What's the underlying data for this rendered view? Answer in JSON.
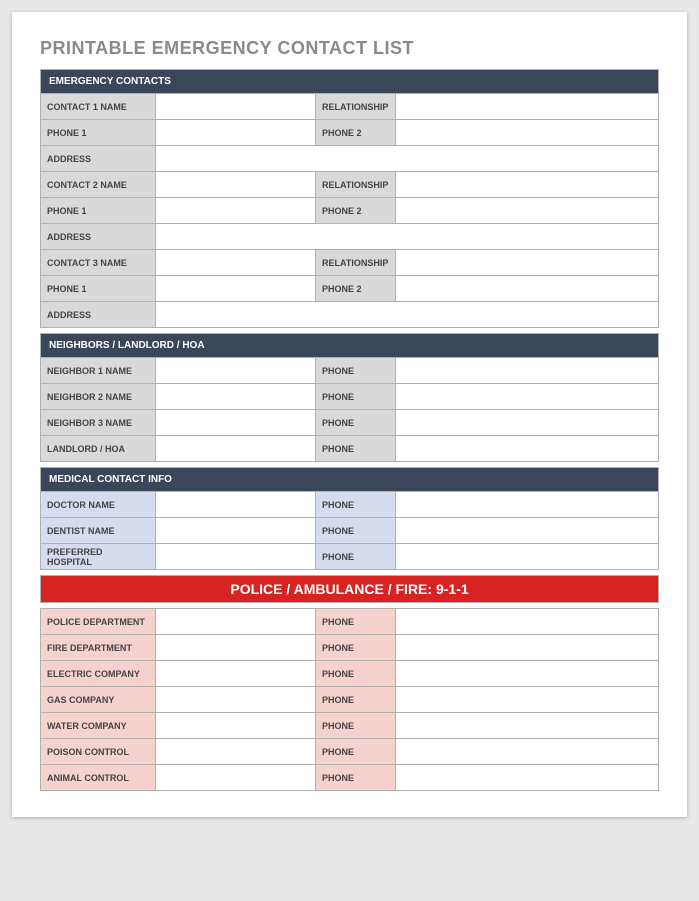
{
  "title": "PRINTABLE EMERGENCY CONTACT LIST",
  "sections": {
    "emergency": {
      "header": "EMERGENCY CONTACTS",
      "contacts": [
        {
          "name_label": "CONTACT 1 NAME",
          "rel_label": "RELATIONSHIP",
          "phone1_label": "PHONE 1",
          "phone2_label": "PHONE 2",
          "addr_label": "ADDRESS"
        },
        {
          "name_label": "CONTACT 2 NAME",
          "rel_label": "RELATIONSHIP",
          "phone1_label": "PHONE 1",
          "phone2_label": "PHONE 2",
          "addr_label": "ADDRESS"
        },
        {
          "name_label": "CONTACT 3 NAME",
          "rel_label": "RELATIONSHIP",
          "phone1_label": "PHONE 1",
          "phone2_label": "PHONE 2",
          "addr_label": "ADDRESS"
        }
      ]
    },
    "neighbors": {
      "header": "NEIGHBORS / LANDLORD / HOA",
      "rows": [
        {
          "label": "NEIGHBOR 1 NAME",
          "phone_label": "PHONE"
        },
        {
          "label": "NEIGHBOR 2 NAME",
          "phone_label": "PHONE"
        },
        {
          "label": "NEIGHBOR 3 NAME",
          "phone_label": "PHONE"
        },
        {
          "label": "LANDLORD / HOA",
          "phone_label": "PHONE"
        }
      ]
    },
    "medical": {
      "header": "MEDICAL CONTACT INFO",
      "rows": [
        {
          "label": "DOCTOR NAME",
          "phone_label": "PHONE"
        },
        {
          "label": "DENTIST NAME",
          "phone_label": "PHONE"
        },
        {
          "label": "PREFERRED HOSPITAL",
          "phone_label": "PHONE"
        }
      ]
    },
    "services": {
      "header": "POLICE / AMBULANCE / FIRE:  9-1-1",
      "rows": [
        {
          "label": "POLICE DEPARTMENT",
          "phone_label": "PHONE"
        },
        {
          "label": "FIRE DEPARTMENT",
          "phone_label": "PHONE"
        },
        {
          "label": "ELECTRIC COMPANY",
          "phone_label": "PHONE"
        },
        {
          "label": "GAS COMPANY",
          "phone_label": "PHONE"
        },
        {
          "label": "WATER COMPANY",
          "phone_label": "PHONE"
        },
        {
          "label": "POISON CONTROL",
          "phone_label": "PHONE"
        },
        {
          "label": "ANIMAL CONTROL",
          "phone_label": "PHONE"
        }
      ]
    }
  }
}
